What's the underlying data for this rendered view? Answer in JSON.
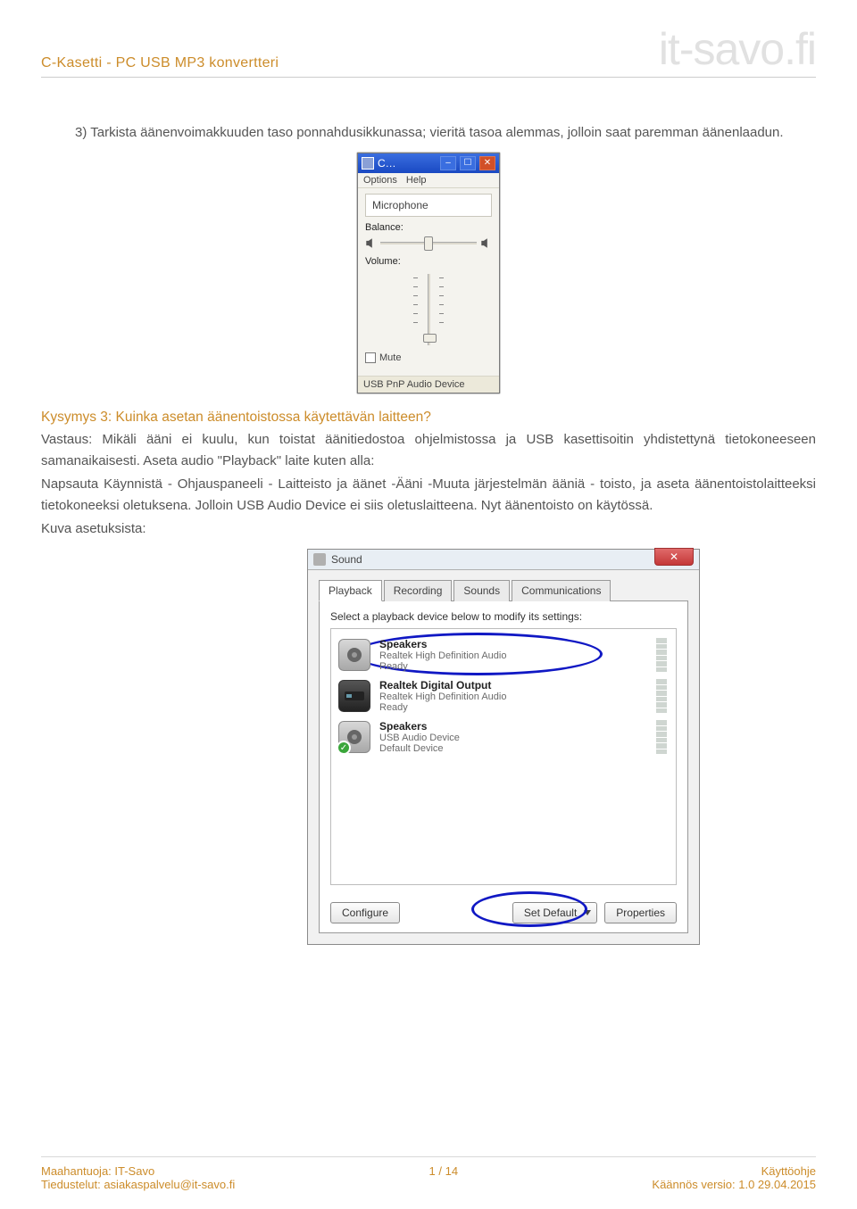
{
  "header": {
    "left": "C-Kasetti - PC USB MP3 konvertteri",
    "right": "it-savo.fi"
  },
  "para1": "3) Tarkista äänenvoimakkuuden taso ponnahdusikkunassa; vieritä tasoa alemmas, jolloin saat paremman äänenlaadun.",
  "question3": "Kysymys 3: Kuinka asetan äänentoistossa käytettävän laitteen?",
  "answer3a": "Vastaus: Mikäli ääni ei kuulu, kun toistat äänitiedostoa ohjelmistossa ja USB kasettisoitin yhdistettynä tietokoneeseen samanaikaisesti. Aseta audio \"Playback\" laite kuten alla:",
  "answer3b": "Napsauta Käynnistä - Ohjauspaneeli - Laitteisto ja äänet -Ääni -Muuta järjestelmän ääniä - toisto, ja aseta äänentoistolaitteeksi tietokoneeksi oletuksena. Jolloin USB Audio Device ei siis oletuslaitteena. Nyt äänentoisto on käytössä.",
  "answer3c": "Kuva asetuksista:",
  "mixer": {
    "title": "C…",
    "menu": {
      "options": "Options",
      "help": "Help"
    },
    "section": "Microphone",
    "balance": "Balance:",
    "volume": "Volume:",
    "mute": "Mute",
    "device": "USB PnP Audio Device"
  },
  "sound": {
    "title": "Sound",
    "close": "✕",
    "tabs": {
      "playback": "Playback",
      "recording": "Recording",
      "sounds": "Sounds",
      "comm": "Communications"
    },
    "hint": "Select a playback device below to modify its settings:",
    "dev1": {
      "name": "Speakers",
      "sub": "Realtek High Definition Audio",
      "state": "Ready"
    },
    "dev2": {
      "name": "Realtek Digital Output",
      "sub": "Realtek High Definition Audio",
      "state": "Ready"
    },
    "dev3": {
      "name": "Speakers",
      "sub": "USB Audio Device",
      "state": "Default Device"
    },
    "buttons": {
      "configure": "Configure",
      "setdefault": "Set Default",
      "properties": "Properties"
    }
  },
  "footer": {
    "l1": "Maahantuoja: IT-Savo",
    "l2": "Tiedustelut: asiakaspalvelu@it-savo.fi",
    "mid": "1 / 14",
    "r1": "Käyttöohje",
    "r2": "Käännös versio: 1.0 29.04.2015"
  }
}
